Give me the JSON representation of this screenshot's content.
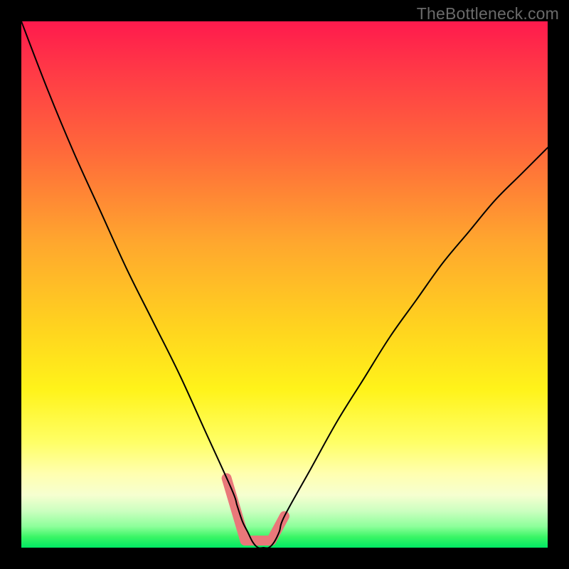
{
  "watermark": "TheBottleneck.com",
  "chart_data": {
    "type": "line",
    "title": "",
    "xlabel": "",
    "ylabel": "",
    "xlim": [
      0,
      100
    ],
    "ylim": [
      0,
      100
    ],
    "grid": false,
    "x": [
      0,
      5,
      10,
      15,
      20,
      25,
      30,
      35,
      40,
      41,
      42,
      43,
      44,
      45,
      46,
      47,
      48,
      49,
      50,
      55,
      60,
      65,
      70,
      75,
      80,
      85,
      90,
      95,
      100
    ],
    "values": [
      100,
      87,
      75,
      64,
      53,
      43,
      33,
      22,
      11,
      8,
      5,
      3,
      1,
      0,
      0,
      0,
      1,
      3,
      6,
      15,
      24,
      32,
      40,
      47,
      54,
      60,
      66,
      71,
      76
    ],
    "highlight_x_range": [
      39,
      50
    ],
    "legend": false
  }
}
